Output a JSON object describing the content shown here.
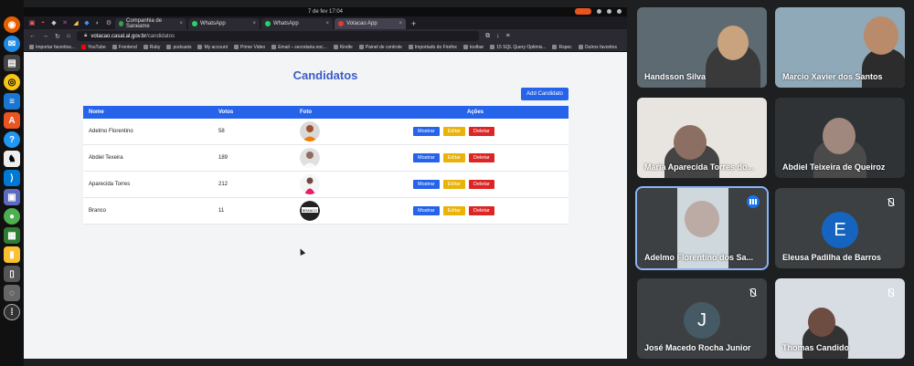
{
  "system": {
    "clock": "7 de fev  17:04"
  },
  "browser": {
    "tabs": [
      {
        "label": "Companhia de Saneame",
        "color": "#2ea44f",
        "active": false
      },
      {
        "label": "WhatsApp",
        "color": "#25d366",
        "active": false
      },
      {
        "label": "WhatsApp",
        "color": "#25d366",
        "active": false
      },
      {
        "label": "Votacao App",
        "color": "#e53935",
        "active": true
      }
    ],
    "new_tab": "+",
    "url_host": "votacao.casal.al.gov.br",
    "url_path": "/candidatos",
    "bookmarks": [
      "Importar favoritos...",
      "YouTube",
      "Frontend",
      "Ruby",
      "podcasts",
      "My account",
      "Prime Video",
      "Email – secretaria.noc...",
      "Kindle",
      "Painel de controle",
      "Importado do Firefox",
      "toolbar",
      "15 SQL Query Optimis...",
      "Rspec",
      "Outros favoritos"
    ]
  },
  "app": {
    "title": "Candidatos",
    "add_button": "Add Candidato",
    "columns": {
      "name": "Nome",
      "votes": "Votos",
      "photo": "Foto",
      "actions": "Ações"
    },
    "actions": {
      "show": "Mostrar",
      "edit": "Editar",
      "delete": "Deletar"
    },
    "rows": [
      {
        "name": "Adelmo Florentino",
        "votes": "58",
        "photo": "orange"
      },
      {
        "name": "Abdiel Texeira",
        "votes": "189",
        "photo": "white"
      },
      {
        "name": "Aparecida Torres",
        "votes": "212",
        "photo": "woman"
      },
      {
        "name": "Branco",
        "votes": "11",
        "photo": "branco"
      }
    ],
    "branco_logo": "BRANCO"
  },
  "meet": {
    "participants": [
      {
        "name": "Handsson Silva",
        "avatar": "",
        "mic": "none"
      },
      {
        "name": "Marcio Xavier dos Santos",
        "avatar": "",
        "mic": "none"
      },
      {
        "name": "Maria Aparecida Torres do...",
        "avatar": "",
        "mic": "none"
      },
      {
        "name": "Abdiel Teixeira de Queiroz",
        "avatar": "",
        "mic": "none"
      },
      {
        "name": "Adelmo Florentino dos Sa...",
        "avatar": "",
        "mic": "speaking"
      },
      {
        "name": "Eleusa Padilha de Barros",
        "avatar": "E",
        "mic": "muted"
      },
      {
        "name": "José Macedo Rocha Junior",
        "avatar": "J",
        "mic": "muted"
      },
      {
        "name": "Thomas Candido",
        "avatar": "",
        "mic": "muted"
      }
    ]
  },
  "colors": {
    "primary": "#2563eb",
    "warning": "#eab308",
    "danger": "#dc2626",
    "title": "#3b5dc9"
  }
}
